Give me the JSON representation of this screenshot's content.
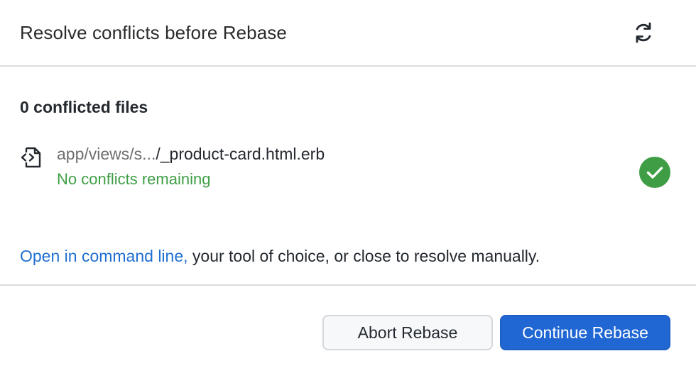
{
  "dialog": {
    "title": "Resolve conflicts before Rebase",
    "refresh_icon": "refresh-icon"
  },
  "summary": {
    "conflict_count_text": "0 conflicted files"
  },
  "files": [
    {
      "icon": "file-code-icon",
      "path_dir": "app/views/s...",
      "path_file": "/_product-card.html.erb",
      "status": "No conflicts remaining",
      "status_icon": "check-circle-icon",
      "status_color": "#3f9e45"
    }
  ],
  "help": {
    "link_text": "Open in command line,",
    "rest_text": " your tool of choice, or close to resolve manually."
  },
  "footer": {
    "abort_label": "Abort Rebase",
    "continue_label": "Continue Rebase"
  },
  "colors": {
    "accent": "#2067d4",
    "link": "#1f6fd1",
    "success": "#3f9e45"
  }
}
